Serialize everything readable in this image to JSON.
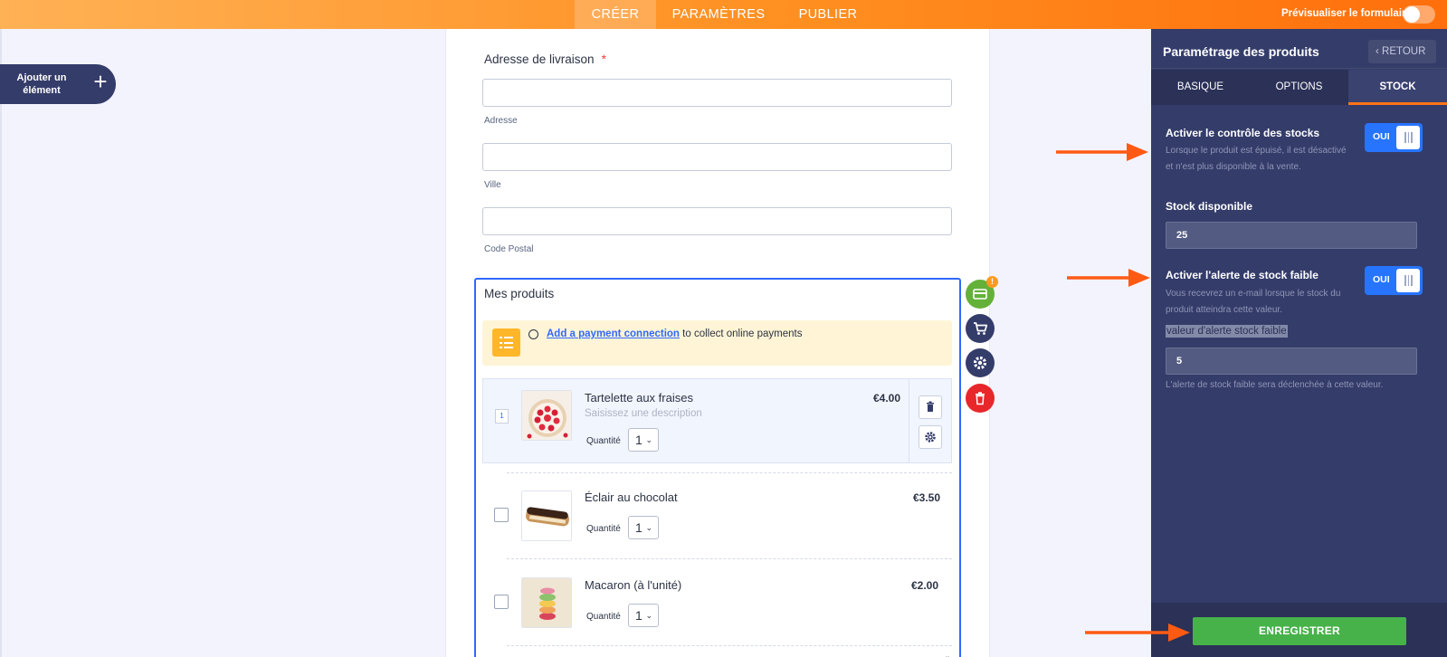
{
  "header": {
    "tabs": [
      {
        "label": "CRÉER"
      },
      {
        "label": "PARAMÈTRES"
      },
      {
        "label": "PUBLIER"
      }
    ],
    "preview_label": "Prévisualiser le formulaire"
  },
  "add_element": {
    "label": "Ajouter un élément"
  },
  "form": {
    "address_label": "Adresse de livraison",
    "required_mark": "*",
    "fields": [
      {
        "sublabel": "Adresse",
        "value": ""
      },
      {
        "sublabel": "Ville",
        "value": ""
      },
      {
        "sublabel": "Code Postal",
        "value": ""
      }
    ],
    "products_title": "Mes produits",
    "payment": {
      "link": "Add a payment connection",
      "text": " to collect online payments"
    },
    "products": [
      {
        "number": "1",
        "name": "Tartelette aux fraises",
        "description_placeholder": "Saisissez une description",
        "price": "€4.00",
        "qty_label": "Quantité",
        "qty": "1"
      },
      {
        "name": "Éclair au chocolat",
        "price": "€3.50",
        "qty_label": "Quantité",
        "qty": "1"
      },
      {
        "name": "Macaron (à l'unité)",
        "price": "€2.00",
        "qty_label": "Quantité",
        "qty": "1"
      }
    ],
    "alert_badge": "!"
  },
  "panel": {
    "title": "Paramétrage des produits",
    "back": "RETOUR",
    "tabs": [
      {
        "label": "BASIQUE"
      },
      {
        "label": "OPTIONS"
      },
      {
        "label": "STOCK"
      }
    ],
    "stock_control": {
      "label": "Activer le contrôle des stocks",
      "description": "Lorsque le produit est épuisé, il est désactivé et n'est plus disponible à la vente.",
      "toggle": "OUI"
    },
    "stock_available": {
      "label": "Stock disponible",
      "value": "25"
    },
    "low_stock": {
      "label": "Activer l'alerte de stock faible",
      "description": "Vous recevrez un e-mail lorsque le stock du produit atteindra cette valeur.",
      "toggle": "OUI",
      "threshold_label": "valeur d'alerte stock faible",
      "threshold_value": "5",
      "hint": "L'alerte de stock faible sera déclenchée à cette valeur."
    },
    "save": "ENREGISTRER"
  },
  "colors": {
    "accent": "#ff7416",
    "panel_bg": "#343c6a",
    "toggle_on": "#2775ff",
    "save": "#47b24a"
  },
  "icons": [
    "plus-icon",
    "list-icon",
    "trash-icon",
    "gear-icon",
    "credit-card-icon",
    "cart-icon",
    "chevron-left-icon",
    "chevron-down-icon",
    "arrow-icon"
  ]
}
